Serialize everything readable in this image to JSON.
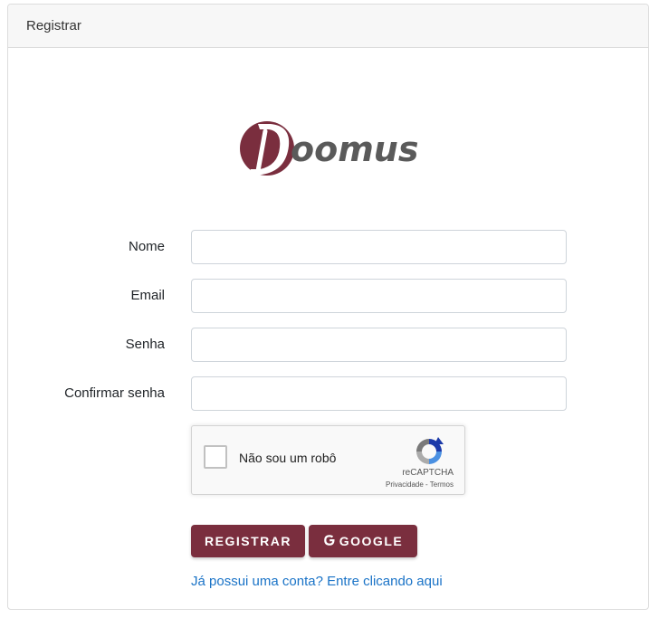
{
  "header": {
    "title": "Registrar"
  },
  "logo": {
    "text": "Doomus",
    "brand_color": "#7a2e3e",
    "text_color": "#5a5a5a"
  },
  "form": {
    "fields": [
      {
        "label": "Nome",
        "value": "",
        "type": "text"
      },
      {
        "label": "Email",
        "value": "",
        "type": "email"
      },
      {
        "label": "Senha",
        "value": "",
        "type": "password"
      },
      {
        "label": "Confirmar senha",
        "value": "",
        "type": "password"
      }
    ]
  },
  "recaptcha": {
    "label": "Não sou um robô",
    "brand": "reCAPTCHA",
    "privacy": "Privacidade",
    "separator": " - ",
    "terms": "Termos",
    "checked": false
  },
  "buttons": {
    "register": "REGISTRAR",
    "google": "GOOGLE",
    "google_icon": "google-g-icon"
  },
  "login_link": "Já possui uma conta? Entre clicando aqui",
  "colors": {
    "primary": "#7a2e3e",
    "link": "#1a73c7"
  }
}
